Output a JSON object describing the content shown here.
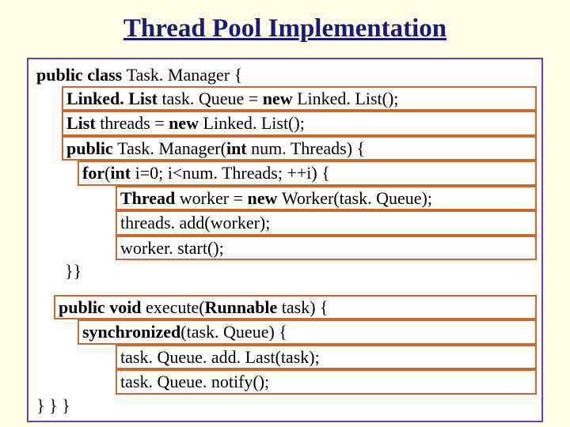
{
  "title": "Thread Pool Implementation",
  "code": {
    "l1a": "public class ",
    "l1b": "Task. Manager {",
    "l2a": "Linked. List ",
    "l2b": "task. Queue = ",
    "l2c": "new ",
    "l2d": "Linked. List();",
    "l3a": "List ",
    "l3b": "threads = ",
    "l3c": "new ",
    "l3d": "Linked. List();",
    "l4a": "public ",
    "l4b": "Task. Manager(",
    "l4c": "int ",
    "l4d": "num. Threads) {",
    "l5a": "for",
    "l5b": "(",
    "l5c": "int ",
    "l5d": "i=0; i<num. Threads; ++i) {",
    "l6a": "Thread ",
    "l6b": "worker = ",
    "l6c": "new ",
    "l6d": "Worker(task. Queue);",
    "l7": "threads. add(worker);",
    "l8": "worker. start();",
    "l9": "}}",
    "l10a": "public void ",
    "l10b": "execute(",
    "l10c": "Runnable ",
    "l10d": "task) {",
    "l11a": "synchronized",
    "l11b": "(task. Queue) {",
    "l12": "task. Queue. add. Last(task);",
    "l13": "task. Queue. notify();",
    "l14": "} } }"
  }
}
